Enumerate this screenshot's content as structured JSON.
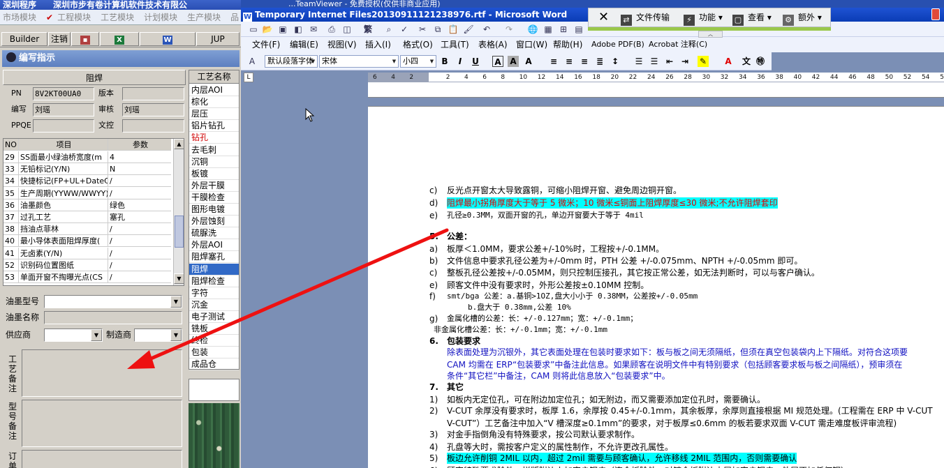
{
  "left_app": {
    "title": "深圳程序",
    "org": "深圳市步有卷计算机软件技术有限公",
    "menu": [
      "市场模块",
      "工程模块",
      "工艺模块",
      "计划模块",
      "生产模块",
      "品"
    ],
    "toolbar": {
      "builder": "Builder",
      "logout": "注销",
      "jup": "JUP"
    },
    "panel_title": "编写指示",
    "section_header": "阻焊",
    "fields": {
      "pn_label": "PN",
      "pn_value": "8V2KT00UA0",
      "version_label": "版本",
      "version_value": "",
      "writer_label": "编写",
      "writer_value": "刘瑶",
      "reviewer_label": "审核",
      "reviewer_value": "刘瑶",
      "ppqe_label": "PPQE",
      "ppqe_value": "",
      "doc_check_label": "文控",
      "doc_check_value": ""
    },
    "grid": {
      "columns": [
        "NO",
        "项目",
        "参数"
      ],
      "rows": [
        {
          "no": "29",
          "item": "SS面最小绿油桥宽度(m",
          "param": "4"
        },
        {
          "no": "33",
          "item": "无铅标记(Y/N)",
          "param": "N"
        },
        {
          "no": "34",
          "item": "快捷标记(FP+UL+DateCo",
          "param": "/"
        },
        {
          "no": "35",
          "item": "生产周期(YYWW/WWYY)",
          "param": "/"
        },
        {
          "no": "36",
          "item": "油墨颜色",
          "param": "绿色"
        },
        {
          "no": "37",
          "item": "过孔工艺",
          "param": "塞孔"
        },
        {
          "no": "38",
          "item": "挡油点菲林",
          "param": "/"
        },
        {
          "no": "40",
          "item": "最小导体表面阻焊厚度(",
          "param": "/"
        },
        {
          "no": "41",
          "item": "无卤素(Y/N)",
          "param": "/"
        },
        {
          "no": "52",
          "item": "识别码位置图纸",
          "param": "/"
        },
        {
          "no": "53",
          "item": "单面开窗不掏曝光点(CS",
          "param": "/"
        }
      ]
    },
    "ink_model_label": "油墨型号",
    "ink_name_label": "油墨名称",
    "supplier_label": "供应商",
    "manufacturer_label": "制造商",
    "process_note_label": "工艺备注",
    "model_note_label": "型号备注",
    "order_note_label": "订单",
    "process_list": {
      "header": "工艺名称",
      "items": [
        {
          "name": "内层AOI",
          "state": "normal"
        },
        {
          "name": "棕化",
          "state": "normal"
        },
        {
          "name": "层压",
          "state": "normal"
        },
        {
          "name": "铝片钻孔",
          "state": "normal"
        },
        {
          "name": "钻孔",
          "state": "red"
        },
        {
          "name": "去毛刺",
          "state": "normal"
        },
        {
          "name": "沉铜",
          "state": "normal"
        },
        {
          "name": "板镀",
          "state": "normal"
        },
        {
          "name": "外层干膜",
          "state": "normal"
        },
        {
          "name": "干膜检查",
          "state": "normal"
        },
        {
          "name": "图形电镀",
          "state": "normal"
        },
        {
          "name": "外层蚀刻",
          "state": "normal"
        },
        {
          "name": "硫脲洗",
          "state": "normal"
        },
        {
          "name": "外层AOI",
          "state": "normal"
        },
        {
          "name": "阻焊塞孔",
          "state": "normal"
        },
        {
          "name": "阻焊",
          "state": "selected"
        },
        {
          "name": "阻焊检查",
          "state": "normal"
        },
        {
          "name": "字符",
          "state": "normal"
        },
        {
          "name": "沉金",
          "state": "normal"
        },
        {
          "name": "电子测试",
          "state": "normal"
        },
        {
          "name": "铣板",
          "state": "normal"
        },
        {
          "name": "终检",
          "state": "normal"
        },
        {
          "name": "包装",
          "state": "normal"
        },
        {
          "name": "成品仓",
          "state": "normal"
        }
      ]
    }
  },
  "word": {
    "back_title": "...TeamViewer - 免费授权(仅供非商业应用)",
    "title": "Temporary Internet Files20130911121238976.rtf - Microsoft Word",
    "menu": [
      "文件(F)",
      "编辑(E)",
      "视图(V)",
      "插入(I)",
      "格式(O)",
      "工具(T)",
      "表格(A)",
      "窗口(W)",
      "帮助(H)",
      "Adobe PDF(B)",
      "Acrobat 注释(C)"
    ],
    "style_combo": "默认段落字体",
    "font_combo": "宋体",
    "size_combo": "小四",
    "remote_toolbar": {
      "file_transfer": "文件传输",
      "functions": "功能",
      "view": "查看",
      "extra": "额外"
    },
    "ruler_numbers": [
      "6",
      "4",
      "2",
      "",
      "2",
      "4",
      "6",
      "8",
      "10",
      "12",
      "14",
      "16",
      "18",
      "20",
      "22",
      "24",
      "26",
      "28",
      "30",
      "32",
      "34",
      "36",
      "38",
      "40",
      "42",
      "44",
      "46",
      "48",
      "50",
      "52",
      "54",
      "56"
    ],
    "doc_lines": [
      {
        "n": "c)",
        "text": "反光点开窗太大导致露铜，可缩小阻焊开窗、避免周边铜开窗。",
        "style": ""
      },
      {
        "n": "d)",
        "text": "阻焊最小拐角厚度大于等于 5 微米；10 微米≤铜面上阻焊厚度≤30 微米;不允许阻焊套印",
        "style": "cyan-red"
      },
      {
        "n": "e)",
        "text": "孔径≥0.3MM，双面开窗的孔，单边开窗要大于等于 4mil",
        "style": "mono"
      },
      {
        "n": "5.",
        "text": "公差：",
        "style": "bold"
      },
      {
        "n": "a)",
        "text": "板厚＜1.0MM，要求公差+/-10%时，工程按+/-0.1MM。",
        "style": ""
      },
      {
        "n": "b)",
        "text": "文件信息中要求孔径公差为+/-0mm 时，PTH 公差 +/-0.075mm、NPTH +/-0.05mm 即可。",
        "style": ""
      },
      {
        "n": "c)",
        "text": "整板孔径公差按+/-0.05MM，则只控制压接孔，其它按正常公差，如无法判断时，可以与客户确认。",
        "style": ""
      },
      {
        "n": "e)",
        "text": "顾客文件中没有要求时，外形公差按±0.10MM 控制。",
        "style": ""
      },
      {
        "n": "f)",
        "text": "smt/bga 公差：a.基铜>1OZ,盘大小小于 0.38MM，公差按+/-0.05mm",
        "style": "mono"
      },
      {
        "n": "",
        "text": "b.盘大于 0.38mm,公差 10%",
        "style": "mono"
      },
      {
        "n": "g)",
        "text": "金属化槽的公差：长：+/-0.127mm；宽：+/-0.1mm；",
        "style": "mono"
      },
      {
        "n": "",
        "text": "非金属化槽公差：长：+/-0.1mm；宽：+/-0.1mm",
        "style": "mono"
      },
      {
        "n": "6.",
        "text": "包装要求",
        "style": "bold"
      },
      {
        "n": "",
        "text": "除表面处理为沉银外，其它表面处理在包装时要求如下：板与板之间无须隔纸，但须在真空包装袋内上下隔纸。对符合这项要",
        "style": "blue-cyan"
      },
      {
        "n": "",
        "text": "CAM 均需在 ERP“包装要求”中备注此信息。如果顾客在说明文件中有特别要求（包括顾客要求板与板之间隔纸），预审须在",
        "style": "blue-red"
      },
      {
        "n": "",
        "text": "条件“其它栏”中备注，CAM 则将此信息放入“包装要求”中。",
        "style": "blue"
      },
      {
        "n": "7.",
        "text": "其它",
        "style": "bold"
      },
      {
        "n": "1)",
        "text": "如板内无定位孔，可在附边加定位孔；如无附边，而又需要添加定位孔时，需要确认。",
        "style": ""
      },
      {
        "n": "2)",
        "text": "V-CUT 余厚没有要求时，板厚 1.6，余厚按 0.45+/-0.1mm，其余板厚，余厚则直接根据 MI 规范处理。(工程需在 ERP 中 V-CUT",
        "style": "vcut"
      },
      {
        "n": "",
        "text": "V-CUT”）工艺备注中加入“V 槽深度≥0.1mm”的要求，对于板厚≤0.6mm 的板若要求双面 V-CUT 需走难度板评审流程)",
        "style": ""
      },
      {
        "n": "3)",
        "text": "对金手指倒角没有特殊要求，按公司默认要求制作。",
        "style": ""
      },
      {
        "n": "4)",
        "text": "孔盘等大时，需按客户定义的属性制作，不允许更改孔属性。",
        "style": ""
      },
      {
        "n": "5)",
        "text": "板边允许削铜 2MIL 以内，超过 2mil 需要与顾客确认，允许移线 2MIL 范围内，否则需要确认",
        "style": "cyan"
      },
      {
        "n": "6)",
        "text": "顾客特殊要求除外，拼版附边上加客户铜皮（连金板除外，对镀金板附边内层加客户铜皮，外层不加任何铜）",
        "style": ""
      }
    ]
  }
}
